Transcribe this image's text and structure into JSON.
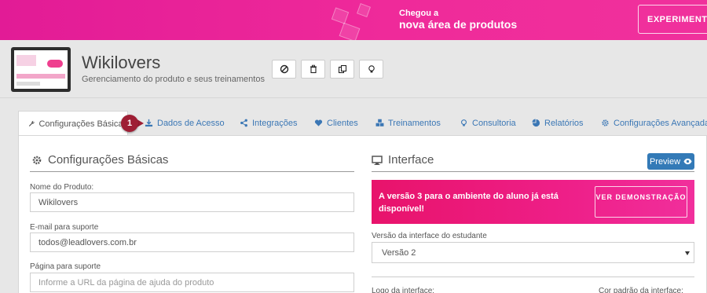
{
  "banner": {
    "line1": "Chegou a",
    "line2": "nova área de produtos",
    "cta_label": "EXPERIMENTE",
    "gradient_start": "#e21b96",
    "gradient_end": "#f0319c"
  },
  "product": {
    "title": "Wikilovers",
    "subtitle": "Gerenciamento do produto e seus treinamentos",
    "toolbar": [
      "block-icon",
      "trash-icon",
      "copy-icon",
      "lightbulb-icon"
    ]
  },
  "tabs": [
    {
      "label": "Configurações Básicas",
      "icon": "wrench-icon",
      "active": true
    },
    {
      "label": "Dados de Acesso",
      "icon": "download-icon"
    },
    {
      "label": "Integrações",
      "icon": "share-icon"
    },
    {
      "label": "Clientes",
      "icon": "heart-icon"
    },
    {
      "label": "Treinamentos",
      "icon": "cubes-icon"
    },
    {
      "label": "Consultoria",
      "icon": "lightbulb-icon"
    },
    {
      "label": "Relatórios",
      "icon": "pie-chart-icon"
    },
    {
      "label": "Configurações Avançadas",
      "icon": "gear-icon"
    }
  ],
  "step_badge": "1",
  "basic_config": {
    "title": "Configurações Básicas",
    "product_name_label": "Nome do Produto:",
    "product_name_value": "Wikilovers",
    "support_email_label": "E-mail para suporte",
    "support_email_value": "todos@leadlovers.com.br",
    "support_page_label": "Página para suporte",
    "support_page_placeholder": "Informe a URL da página de ajuda do produto"
  },
  "interface": {
    "title": "Interface",
    "preview_label": "Preview",
    "promo_message": "A versão 3 para o ambiente do aluno já está disponível!",
    "promo_button": "VER DEMONSTRAÇÃO",
    "version_label": "Versão da interface do estudante",
    "version_value": "Versão 2",
    "logo_label": "Logo da interface:",
    "color_label": "Cor padrão da interface:"
  },
  "colors": {
    "accent_link": "#3b77b5",
    "preview_button": "#337ab7",
    "badge": "#9e1e34"
  }
}
